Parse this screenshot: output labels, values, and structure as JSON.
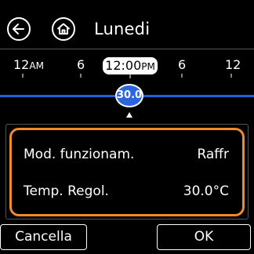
{
  "header": {
    "back_icon": "back-arrow-icon",
    "home_icon": "home-icon",
    "day": "Lunedi"
  },
  "timeline": {
    "ticks": {
      "t0_main": "12",
      "t0_sub": "AM",
      "t1": "6",
      "t2": "6",
      "t3": "12"
    },
    "current_time_main": "12:00",
    "current_time_sub": "PM",
    "setpoint": "30.0",
    "accent_color": "#1e62d9"
  },
  "settings": {
    "mode_label": "Mod. funzionam.",
    "mode_value": "Raffr",
    "temp_label": "Temp. Regol.",
    "temp_value": "30.0°C",
    "highlight_color": "#f08a2a"
  },
  "buttons": {
    "cancel": "Cancella",
    "ok": "OK"
  }
}
